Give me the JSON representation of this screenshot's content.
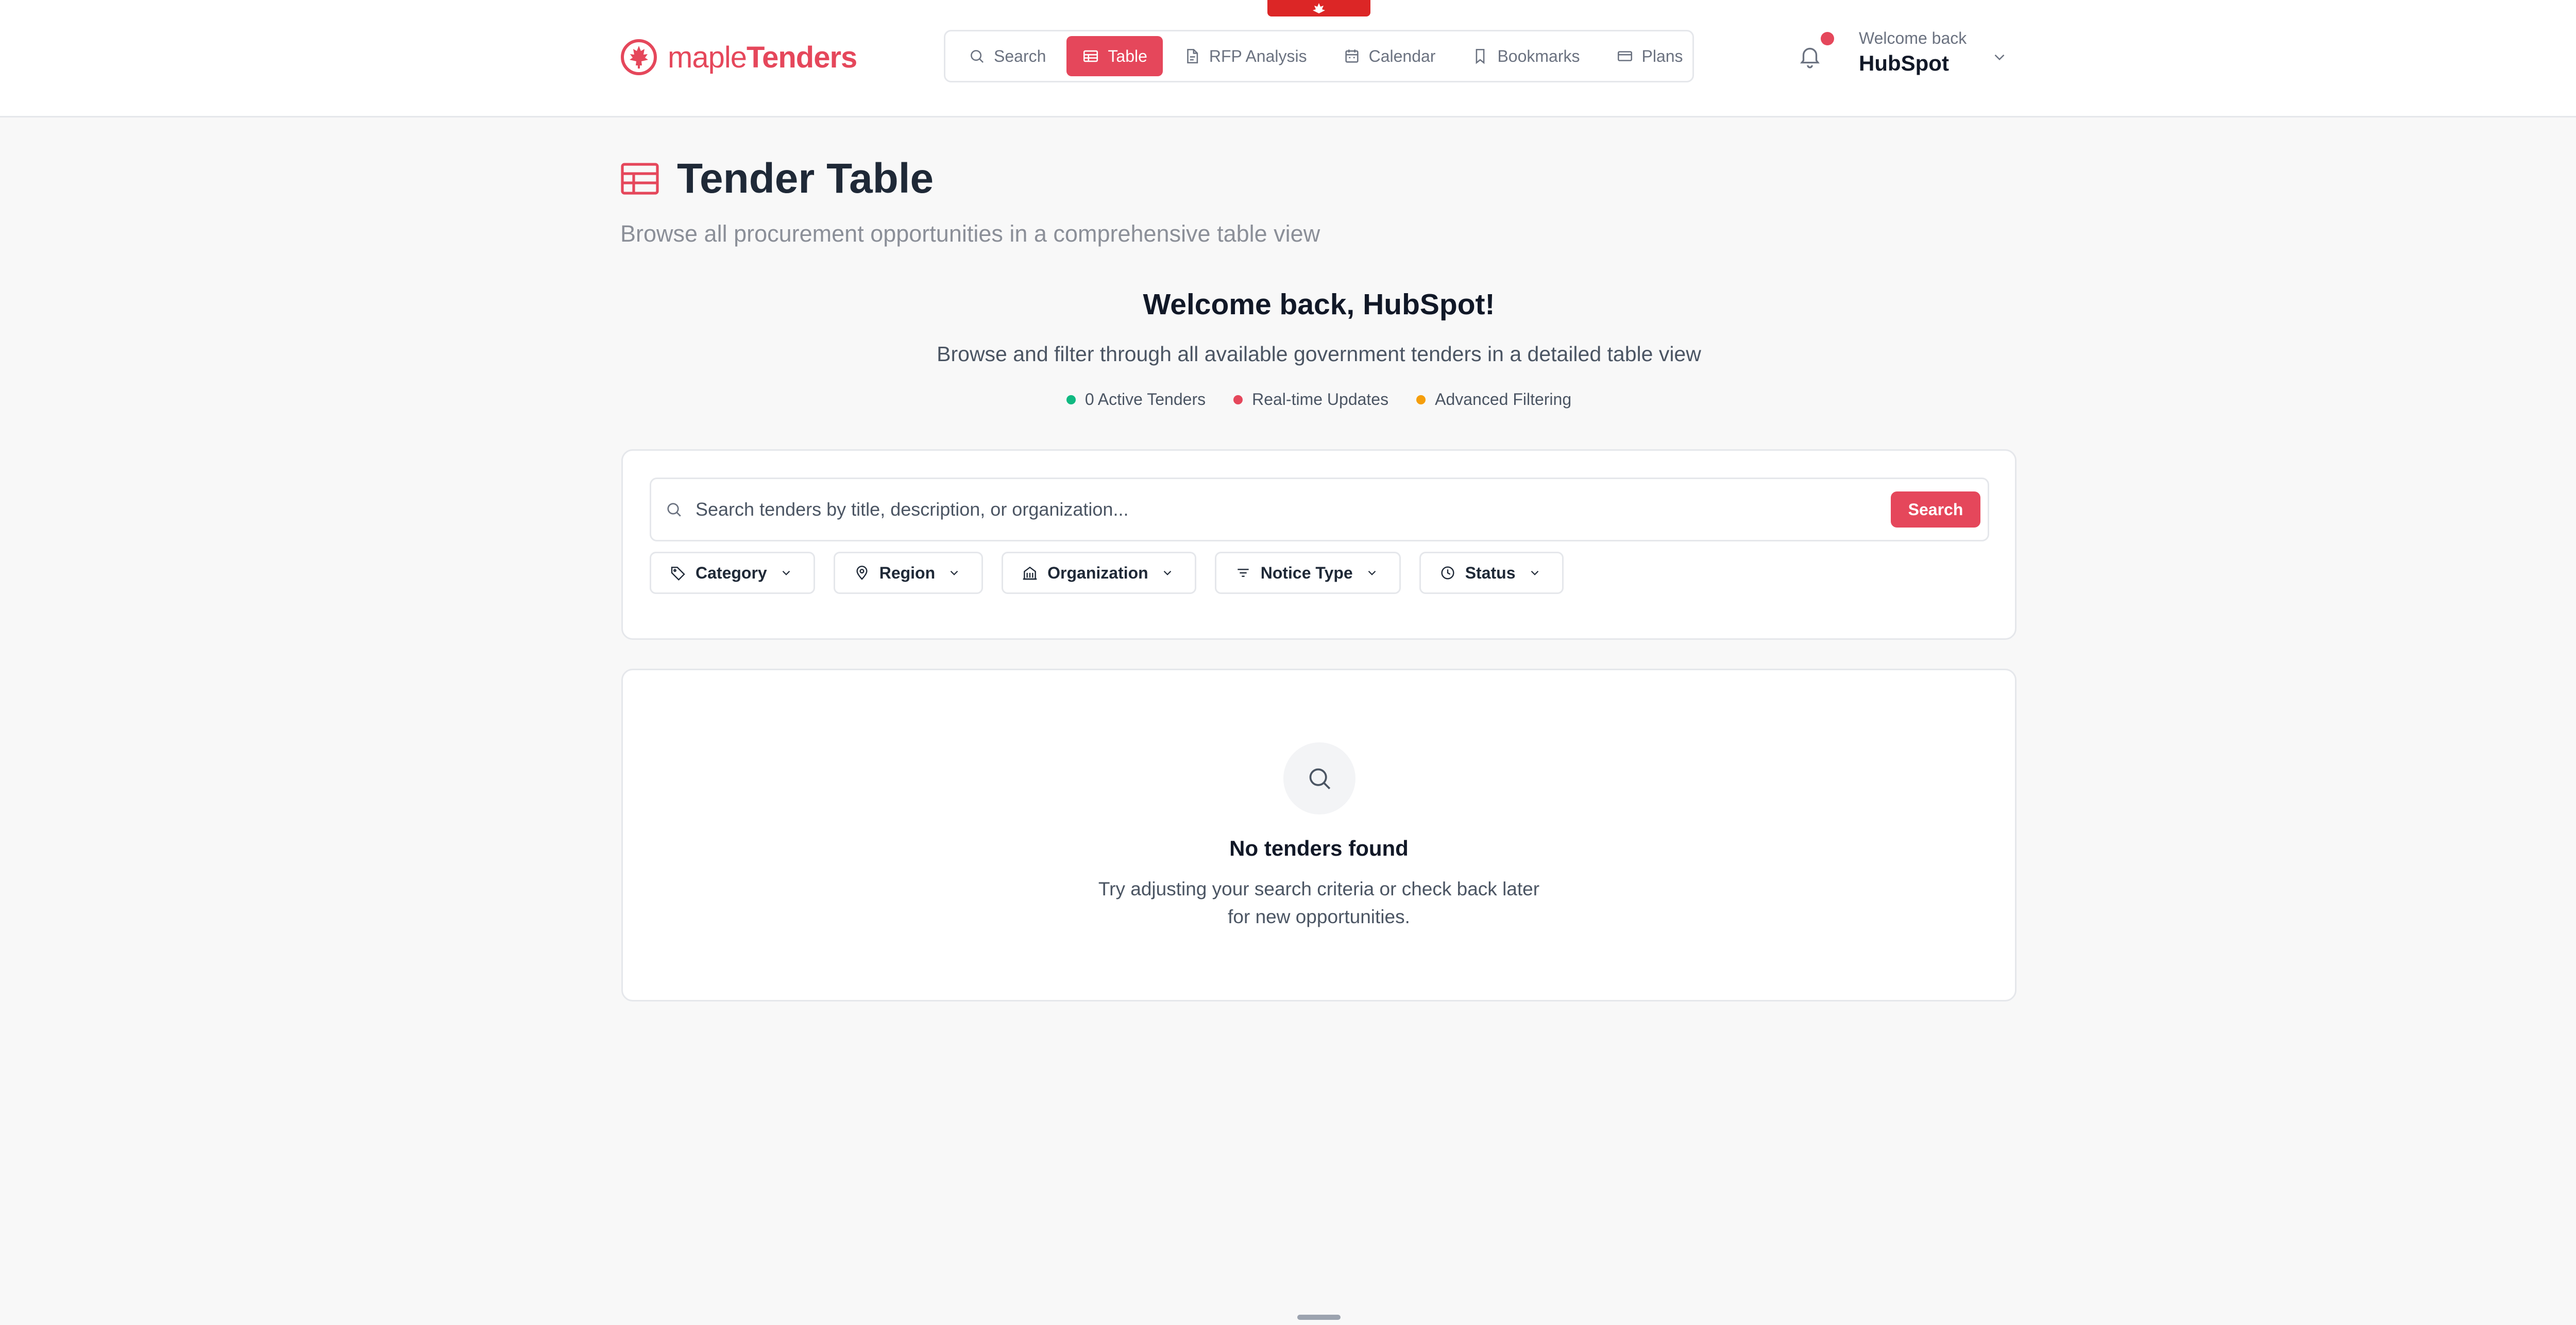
{
  "brand": {
    "prefix": "maple",
    "name": "Tenders",
    "accent": "#e5475b"
  },
  "nav": {
    "items": [
      {
        "label": "Search",
        "icon": "search-icon",
        "active": false
      },
      {
        "label": "Table",
        "icon": "table-icon",
        "active": true
      },
      {
        "label": "RFP Analysis",
        "icon": "document-icon",
        "active": false
      },
      {
        "label": "Calendar",
        "icon": "calendar-icon",
        "active": false
      },
      {
        "label": "Bookmarks",
        "icon": "bookmark-icon",
        "active": false
      },
      {
        "label": "Plans",
        "icon": "credit-card-icon",
        "active": false
      }
    ]
  },
  "user": {
    "greeting": "Welcome back",
    "name": "HubSpot",
    "has_notification": true
  },
  "page": {
    "title": "Tender Table",
    "subtitle": "Browse all procurement opportunities in a comprehensive table view"
  },
  "welcome": {
    "title": "Welcome back, HubSpot!",
    "subtitle": "Browse and filter through all available government tenders in a detailed table view",
    "features": [
      {
        "label": "0 Active Tenders",
        "color": "#10b981"
      },
      {
        "label": "Real-time Updates",
        "color": "#e5475b"
      },
      {
        "label": "Advanced Filtering",
        "color": "#f59e0b"
      }
    ]
  },
  "search": {
    "placeholder": "Search tenders by title, description, or organization...",
    "value": "",
    "button_label": "Search"
  },
  "filters": [
    {
      "label": "Category",
      "icon": "tag-icon"
    },
    {
      "label": "Region",
      "icon": "map-pin-icon"
    },
    {
      "label": "Organization",
      "icon": "building-icon"
    },
    {
      "label": "Notice Type",
      "icon": "filter-icon"
    },
    {
      "label": "Status",
      "icon": "clock-icon"
    }
  ],
  "results": {
    "empty_title": "No tenders found",
    "empty_message": "Try adjusting your search criteria or check back later for new opportunities."
  }
}
